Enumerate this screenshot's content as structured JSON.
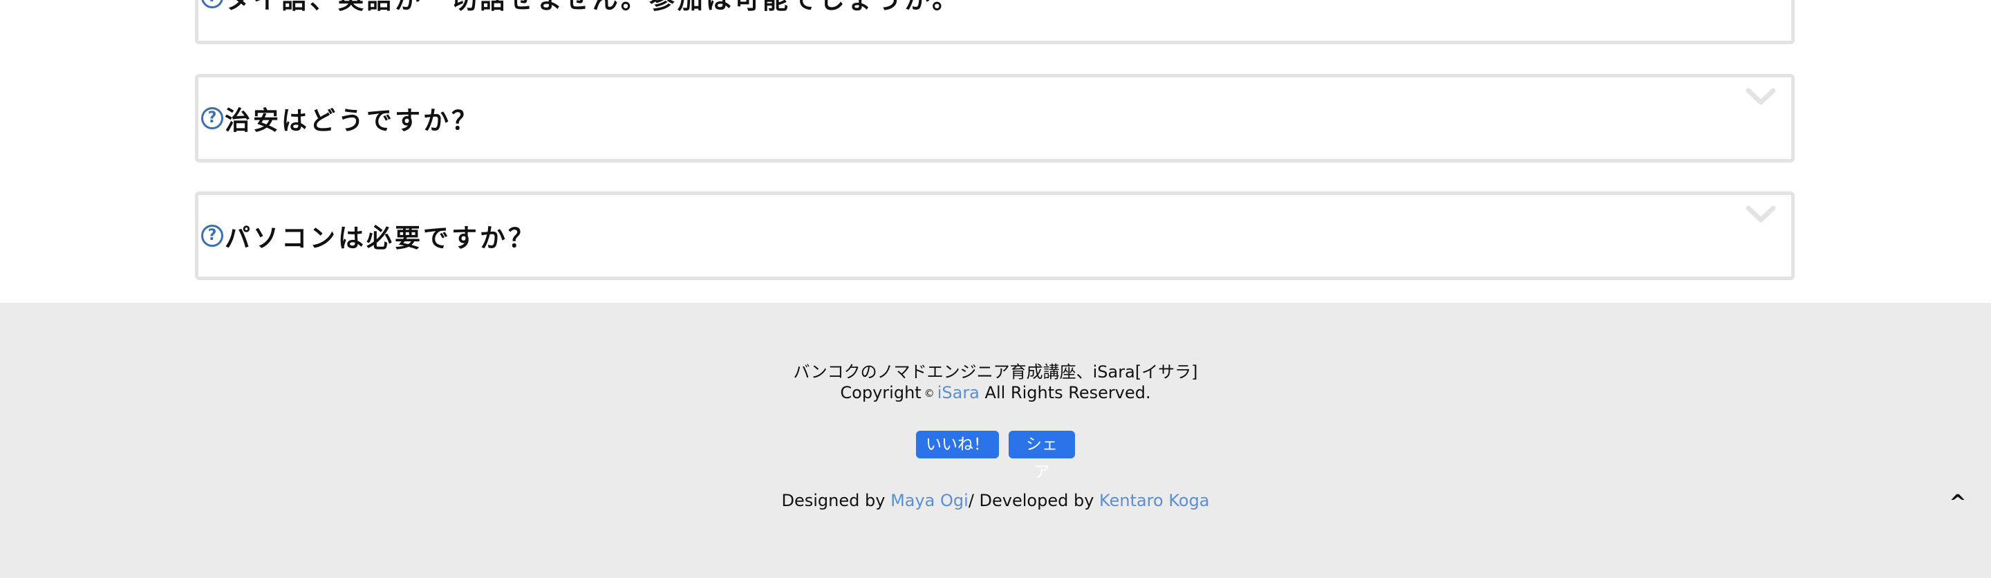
{
  "faq": {
    "items": [
      {
        "question": "タイ語、英語が一切話せません。参加は可能でしょうか。"
      },
      {
        "question": "治安はどうですか？"
      },
      {
        "question": "パソコンは必要ですか？"
      }
    ],
    "question_icon": "question-circle-icon",
    "toggle_icon": "chevron-down-icon"
  },
  "footer": {
    "tagline": "バンコクのノマドエンジニア育成講座、iSara[イサラ]",
    "copyright_prefix": "Copyright",
    "copyright_symbol": "©",
    "copyright_brand": "iSara",
    "copyright_suffix": "All Rights Reserved.",
    "like_button": "いいね！",
    "share_button": "シェア",
    "designed_by_label": "Designed by",
    "designer": "Maya Ogi",
    "developed_by_label": "/ Developed by",
    "developer": "Kentaro Koga",
    "back_to_top": "^"
  },
  "colors": {
    "link": "#5a8fd0",
    "button": "#2a73e8",
    "question_icon": "#3a6fb0",
    "footer_bg": "#ebebeb",
    "card_border": "#e3e3e3"
  }
}
